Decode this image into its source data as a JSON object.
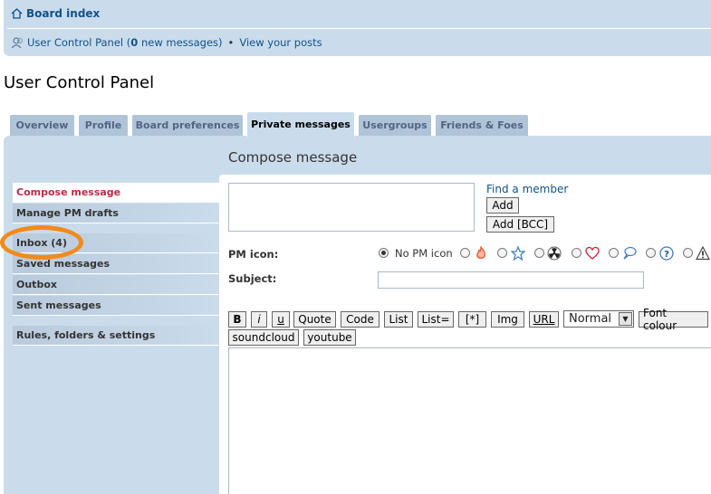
{
  "header": {
    "board_index": "Board index",
    "ucp_link": "User Control Panel",
    "ucp_open": " (",
    "new_count": "0",
    "new_messages": " new messages)",
    "bullet": "•",
    "view_posts": "View your posts"
  },
  "page_title": "User Control Panel",
  "tabs": [
    {
      "label": "Overview"
    },
    {
      "label": "Profile"
    },
    {
      "label": "Board preferences"
    },
    {
      "label": "Private messages"
    },
    {
      "label": "Usergroups"
    },
    {
      "label": "Friends & Foes"
    }
  ],
  "sidebar": {
    "items": [
      {
        "label": "Compose message"
      },
      {
        "label": "Manage PM drafts"
      },
      {
        "label": "Inbox (4)"
      },
      {
        "label": "Saved messages"
      },
      {
        "label": "Outbox"
      },
      {
        "label": "Sent messages"
      },
      {
        "label": "Rules, folders & settings"
      }
    ]
  },
  "compose": {
    "heading": "Compose message",
    "find_member": "Find a member",
    "add_label": "Add",
    "add_bcc_label": "Add [BCC]",
    "pm_icon_label": "PM icon:",
    "no_pm_icon": "No PM icon",
    "subject_label": "Subject:",
    "subject_value": "",
    "icons": [
      "fire-icon",
      "star-icon",
      "radioactive-icon",
      "heart-icon",
      "speech-bubble-icon",
      "question-icon",
      "warning-icon"
    ]
  },
  "toolbar": {
    "bold": "B",
    "italic": "i",
    "underline": "u",
    "quote": "Quote",
    "code": "Code",
    "list": "List",
    "list_eq": "List=",
    "list_item": "[*]",
    "img": "Img",
    "url": "URL",
    "font_size": "Normal",
    "font_colour": "Font colour",
    "soundcloud": "soundcloud",
    "youtube": "youtube"
  },
  "colors": {
    "panel_bg": "#cadceb",
    "link": "#105289",
    "active_menu": "#bc2a4d",
    "highlight_circle": "#f28a1a"
  }
}
